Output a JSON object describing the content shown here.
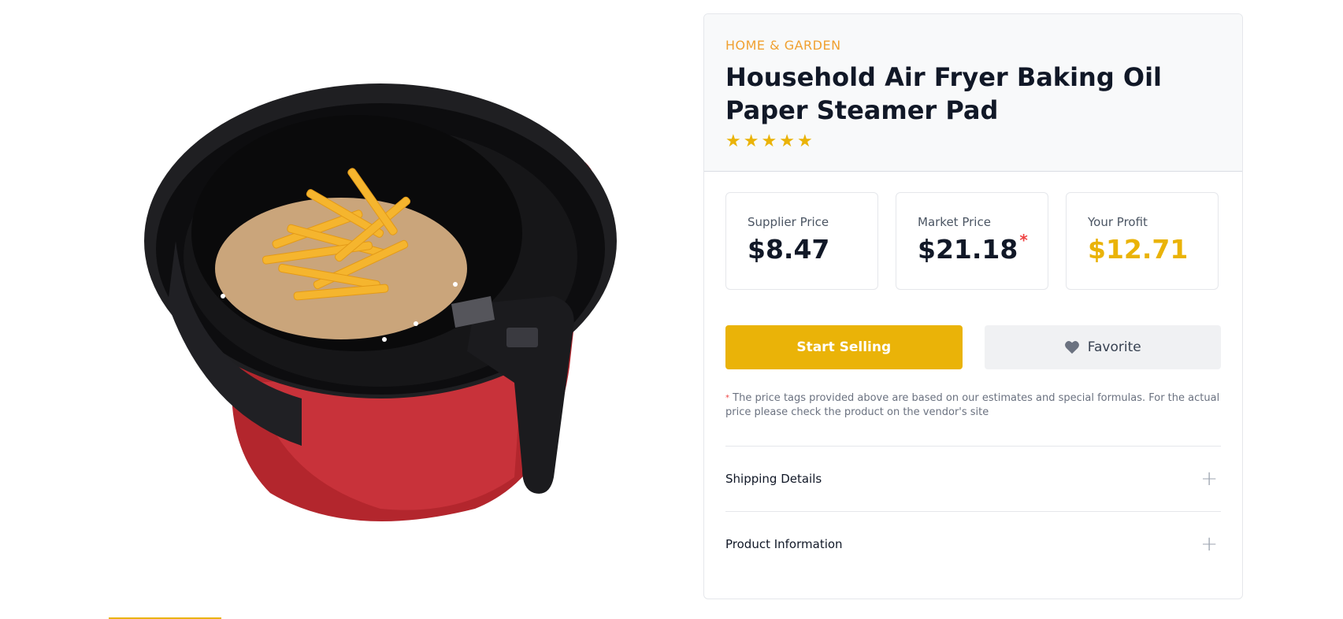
{
  "product": {
    "category": "HOME & GARDEN",
    "title": "Household Air Fryer Baking Oil Paper Steamer Pad",
    "rating_stars": 5,
    "image_alt": "Air fryer basket with paper liner and french fries"
  },
  "prices": {
    "supplier_label": "Supplier Price",
    "supplier_value": "$8.47",
    "market_label": "Market Price",
    "market_value": "$21.18",
    "market_asterisk": "*",
    "profit_label": "Your Profit",
    "profit_value": "$12.71"
  },
  "actions": {
    "start_selling": "Start Selling",
    "favorite": "Favorite"
  },
  "note": {
    "asterisk": "*",
    "text": "The price tags provided above are based on our estimates and special formulas. For the actual price please check the product on the vendor's site"
  },
  "accordion": [
    {
      "label": "Shipping Details",
      "icon": "+"
    },
    {
      "label": "Product Information",
      "icon": "+"
    }
  ],
  "colors": {
    "accent": "#eab308",
    "category": "#f0a030",
    "asterisk": "#ef4444"
  }
}
